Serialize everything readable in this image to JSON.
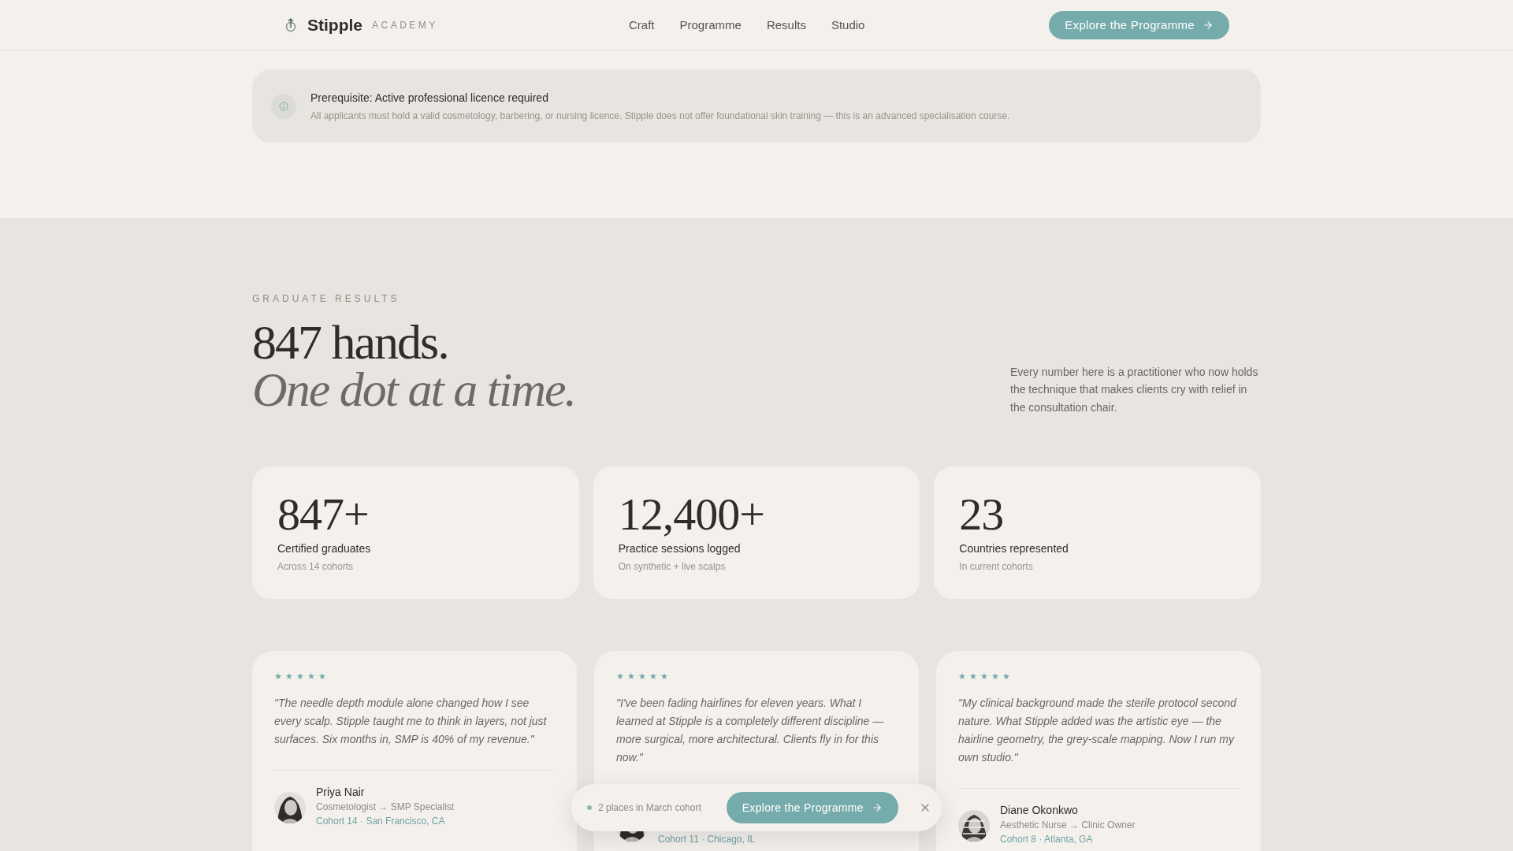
{
  "header": {
    "brand": "Stipple",
    "tagline": "ACADEMY",
    "nav": [
      {
        "label": "Craft"
      },
      {
        "label": "Programme"
      },
      {
        "label": "Results"
      },
      {
        "label": "Studio"
      }
    ],
    "cta": "Explore the Programme"
  },
  "notice": {
    "title": "Prerequisite: Active professional licence required",
    "body": "All applicants must hold a valid cosmetology, barbering, or nursing licence. Stipple does not offer foundational skin training — this is an advanced specialisation course."
  },
  "results": {
    "eyebrow": "GRADUATE RESULTS",
    "heading": "847 hands.",
    "heading_italic": "One dot at a time.",
    "intro": "Every number here is a practitioner who now holds the technique that makes clients cry with relief in the consultation chair.",
    "stats": [
      {
        "value": "847+",
        "label": "Certified graduates",
        "note": "Across 14 cohorts"
      },
      {
        "value": "12,400+",
        "label": "Practice sessions logged",
        "note": "On synthetic + live scalps"
      },
      {
        "value": "23",
        "label": "Countries represented",
        "note": "In current cohorts"
      }
    ],
    "testimonials": [
      {
        "stars": 5,
        "quote": "\"The needle depth module alone changed how I see every scalp. Stipple taught me to think in layers, not just surfaces. Six months in, SMP is 40% of my revenue.\"",
        "name": "Priya Nair",
        "from": "Cosmetologist",
        "arrow": "→",
        "to": "SMP Specialist",
        "separator": "·",
        "cohort": "Cohort 14",
        "location": "San Francisco, CA"
      },
      {
        "stars": 5,
        "quote": "\"I've been fading hairlines for eleven years. What I learned at Stipple is a completely different discipline — more surgical, more architectural. Clients fly in for this now.\"",
        "separator": "·",
        "cohort": "Cohort 11",
        "location": "Chicago, IL"
      },
      {
        "stars": 5,
        "quote": "\"My clinical background made the sterile protocol second nature. What Stipple added was the artistic eye — the hairline geometry, the grey-scale mapping. Now I run my own studio.\"",
        "name": "Diane Okonkwo",
        "from": "Aesthetic Nurse",
        "arrow": "→",
        "to": "Clinic Owner",
        "separator": "·",
        "cohort": "Cohort 8",
        "location": "Atlanta, GA"
      }
    ]
  },
  "sticky_bar": {
    "availability": "2 places in March cohort",
    "cta": "Explore the Programme"
  }
}
